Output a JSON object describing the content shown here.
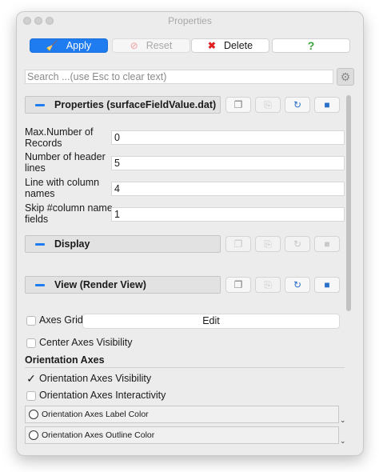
{
  "window": {
    "title": "Properties"
  },
  "toolbar": {
    "apply_label": "Apply",
    "reset_label": "Reset",
    "delete_label": "Delete",
    "help_label": "?"
  },
  "search": {
    "placeholder": "Search ...(use Esc to clear text)"
  },
  "sections": {
    "properties": "Properties (surfaceFieldValue.dat)",
    "display": "Display",
    "view": "View (Render View)"
  },
  "properties": [
    {
      "label": "Max.Number of Records",
      "value": "0"
    },
    {
      "label": "Number of header lines",
      "value": "5"
    },
    {
      "label": "Line with column names",
      "value": "4"
    },
    {
      "label": "Skip #column name fields",
      "value": "1"
    }
  ],
  "view": {
    "axes_grid_label": "Axes Grid",
    "axes_grid_edit": "Edit",
    "center_axes_label": "Center Axes Visibility",
    "orientation_heading": "Orientation Axes",
    "orientation_visibility_label": "Orientation Axes Visibility",
    "orientation_visibility_checked": true,
    "orientation_interactivity_label": "Orientation Axes Interactivity",
    "label_color_label": "Orientation Axes Label Color",
    "outline_color_label": "Orientation Axes Outline Color"
  },
  "colors": {
    "accent": "#1e7cf0",
    "panel": "#ececec"
  }
}
